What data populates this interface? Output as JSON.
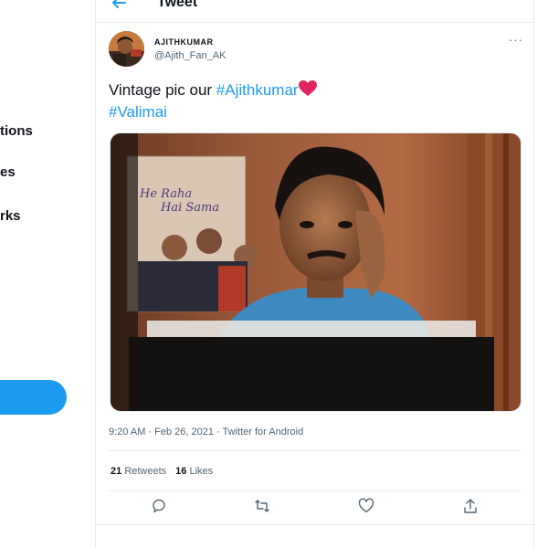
{
  "sidebar": {
    "items": [
      {
        "label": "tions"
      },
      {
        "label": "es"
      },
      {
        "label": "rks"
      }
    ]
  },
  "header": {
    "title": "Tweet",
    "back_icon": "arrow-left-icon"
  },
  "tweet": {
    "author_name": "AJITHKUMAR",
    "author_handle": "@Ajith_Fan_AK",
    "text_prefix": "Vintage pic our ",
    "hashtag1": "#Ajithkumar",
    "hashtag2": "#Valimai",
    "poster_line1": "He Raha",
    "poster_line2": "Hai Sama",
    "timestamp": "9:20 AM · Feb 26, 2021 · Twitter for Android",
    "retweets_count": "21",
    "retweets_label": "Retweets",
    "likes_count": "16",
    "likes_label": "Likes"
  },
  "colors": {
    "accent": "#1d9bf0",
    "heart": "#e0245e"
  }
}
